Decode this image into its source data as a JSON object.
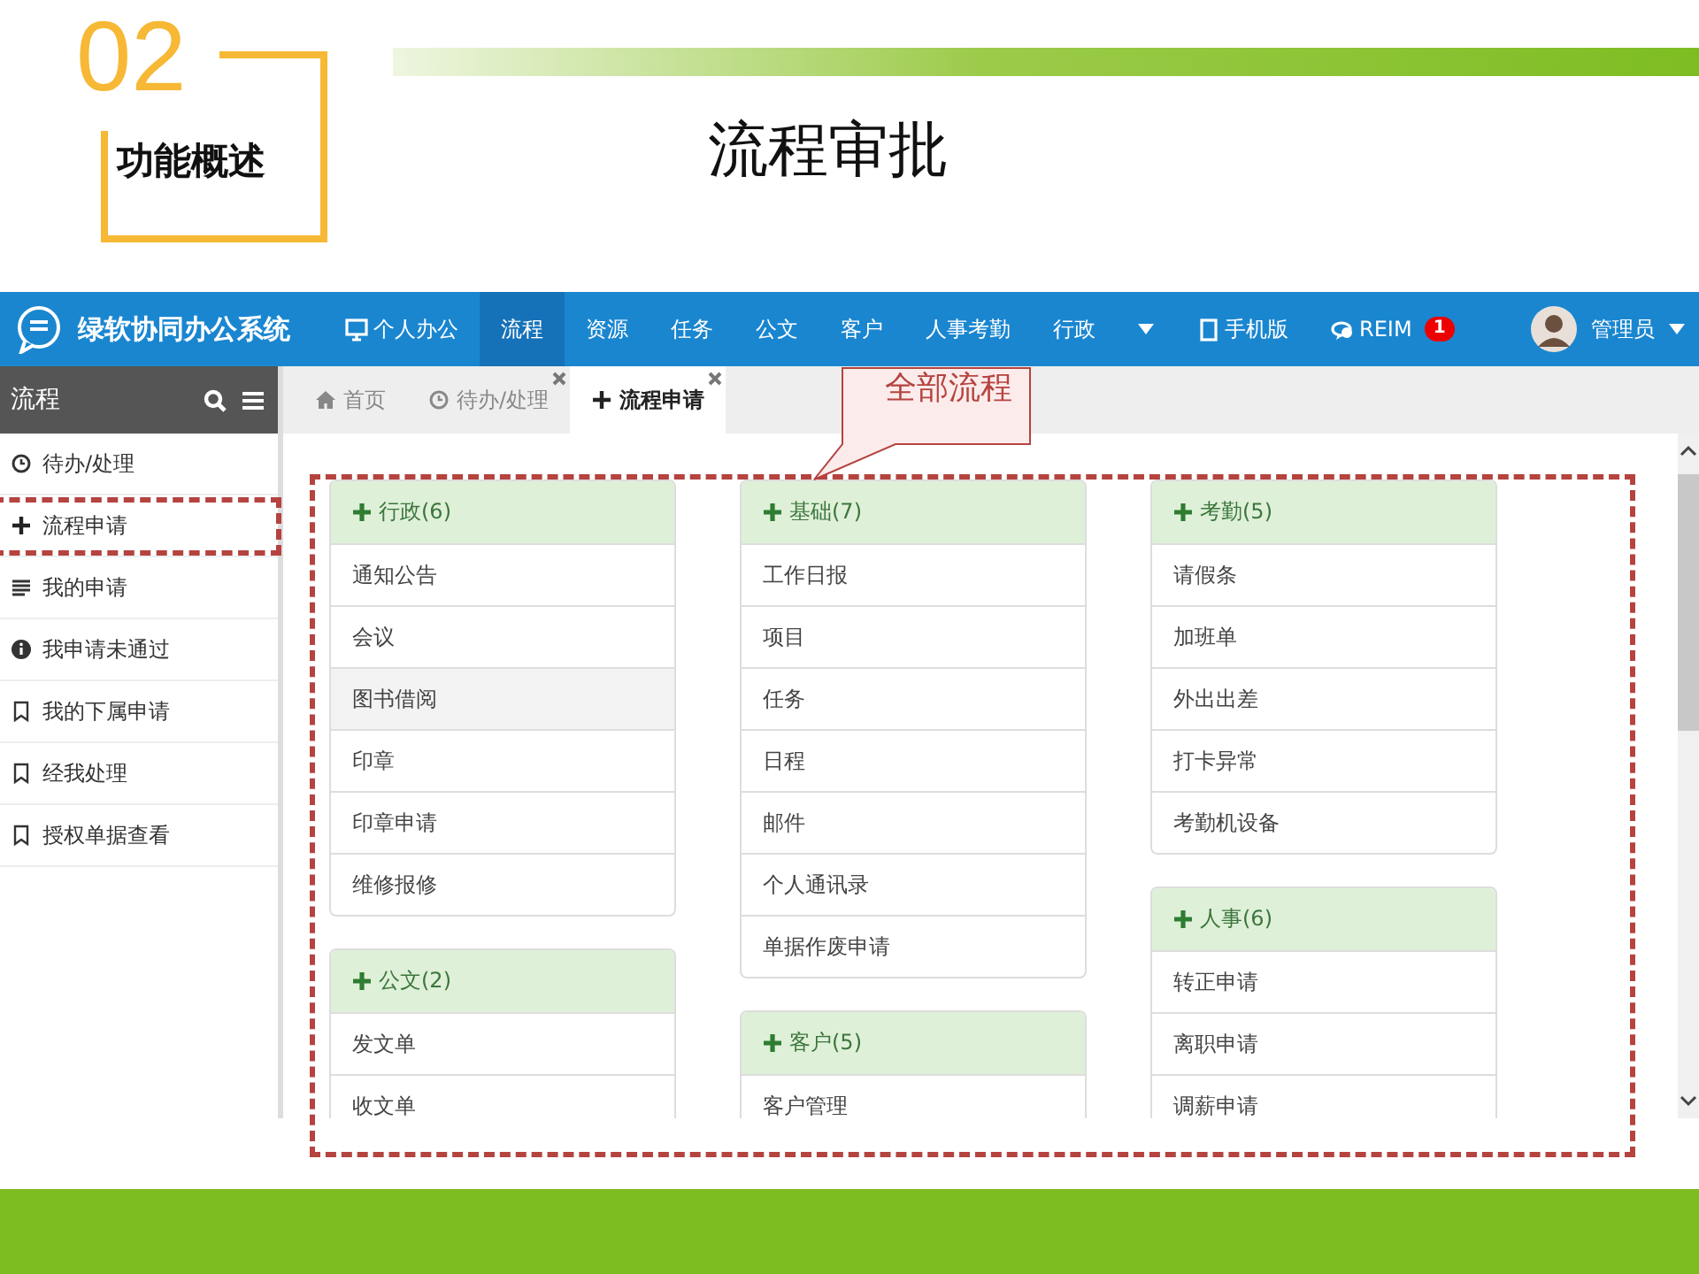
{
  "slide": {
    "number": "02",
    "section": "功能概述",
    "title": "流程审批"
  },
  "app": {
    "brand": "绿软协同办公系统",
    "nav": [
      {
        "kind": "link",
        "label": "个人办公",
        "selected": false
      },
      {
        "kind": "link",
        "label": "流程",
        "selected": true
      },
      {
        "kind": "link",
        "label": "资源",
        "selected": false
      },
      {
        "kind": "link",
        "label": "任务",
        "selected": false
      },
      {
        "kind": "link",
        "label": "公文",
        "selected": false
      },
      {
        "kind": "link",
        "label": "客户",
        "selected": false
      },
      {
        "kind": "link",
        "label": "人事考勤",
        "selected": false
      },
      {
        "kind": "link",
        "label": "行政",
        "selected": false
      },
      {
        "kind": "dropdown",
        "selected": false
      },
      {
        "kind": "link",
        "label": "手机版",
        "selected": false
      },
      {
        "kind": "link",
        "label": "REIM",
        "badge": "1",
        "selected": false
      }
    ],
    "user": "管理员",
    "sidebar": {
      "title": "流程",
      "items": [
        {
          "label": "待办/处理"
        },
        {
          "label": "流程申请"
        },
        {
          "label": "我的申请"
        },
        {
          "label": "我申请未通过"
        },
        {
          "label": "我的下属申请"
        },
        {
          "label": "经我处理"
        },
        {
          "label": "授权单据查看"
        }
      ]
    },
    "tabs": [
      {
        "label": "首页",
        "selected": false,
        "closable": false
      },
      {
        "label": "待办/处理",
        "selected": false,
        "closable": true
      },
      {
        "label": "流程申请",
        "selected": true,
        "closable": true
      }
    ],
    "columns": [
      [
        {
          "title": "行政(6)",
          "rows": [
            {
              "label": "通知公告",
              "hovered": false
            },
            {
              "label": "会议",
              "hovered": false
            },
            {
              "label": "图书借阅",
              "hovered": true
            },
            {
              "label": "印章",
              "hovered": false
            },
            {
              "label": "印章申请",
              "hovered": false
            },
            {
              "label": "维修报修",
              "hovered": false
            }
          ]
        },
        {
          "title": "公文(2)",
          "rows": [
            {
              "label": "发文单",
              "hovered": false
            },
            {
              "label": "收文单",
              "hovered": false
            }
          ]
        }
      ],
      [
        {
          "title": "基础(7)",
          "rows": [
            {
              "label": "工作日报",
              "hovered": false
            },
            {
              "label": "项目",
              "hovered": false
            },
            {
              "label": "任务",
              "hovered": false
            },
            {
              "label": "日程",
              "hovered": false
            },
            {
              "label": "邮件",
              "hovered": false
            },
            {
              "label": "个人通讯录",
              "hovered": false
            },
            {
              "label": "单据作废申请",
              "hovered": false
            }
          ]
        },
        {
          "title": "客户(5)",
          "rows": [
            {
              "label": "客户管理",
              "hovered": false
            }
          ]
        }
      ],
      [
        {
          "title": "考勤(5)",
          "rows": [
            {
              "label": "请假条",
              "hovered": false
            },
            {
              "label": "加班单",
              "hovered": false
            },
            {
              "label": "外出出差",
              "hovered": false
            },
            {
              "label": "打卡异常",
              "hovered": false
            },
            {
              "label": "考勤机设备",
              "hovered": false
            }
          ]
        },
        {
          "title": "人事(6)",
          "rows": [
            {
              "label": "转正申请",
              "hovered": false
            },
            {
              "label": "离职申请",
              "hovered": false
            },
            {
              "label": "调薪申请",
              "hovered": false
            }
          ]
        }
      ]
    ]
  },
  "callout": {
    "text": "全部流程"
  }
}
